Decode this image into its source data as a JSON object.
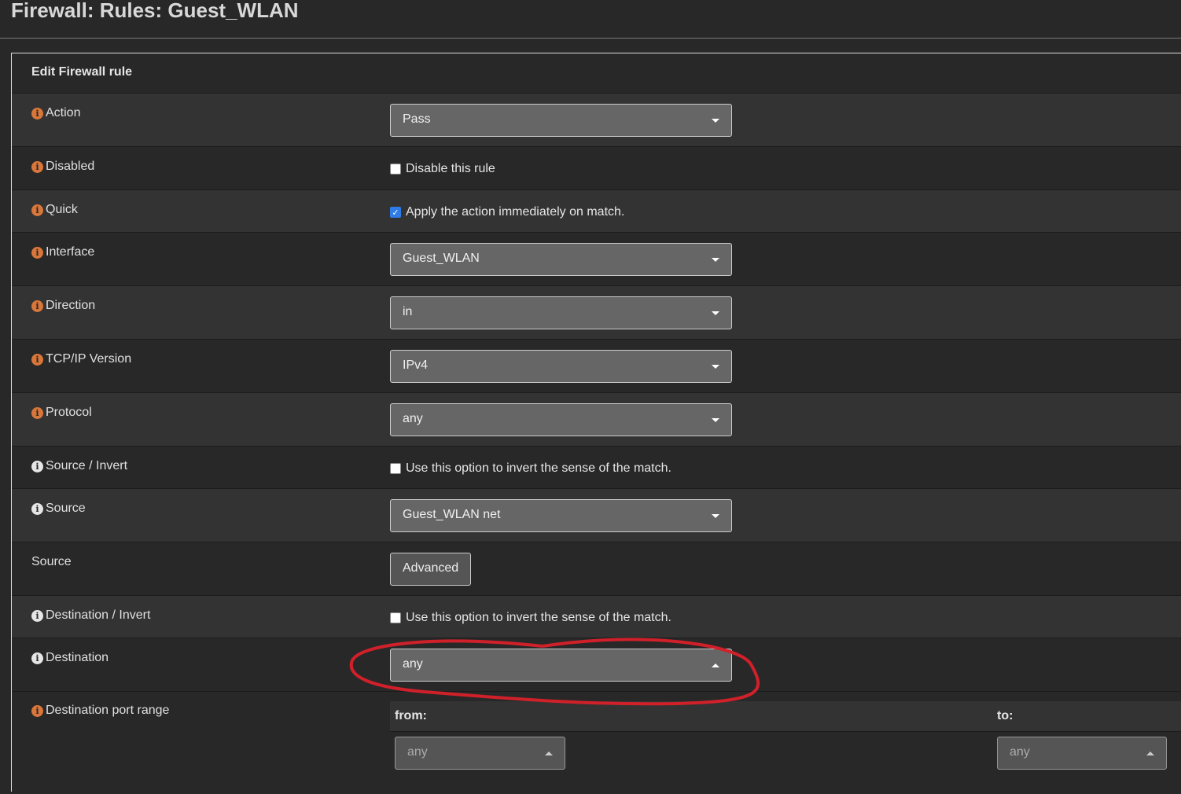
{
  "page_title": "Firewall: Rules: Guest_WLAN",
  "panel_title": "Edit Firewall rule",
  "rows": {
    "action": {
      "label": "Action",
      "value": "Pass"
    },
    "disabled": {
      "label": "Disabled",
      "text": "Disable this rule",
      "checked": false
    },
    "quick": {
      "label": "Quick",
      "text": "Apply the action immediately on match.",
      "checked": true
    },
    "interface": {
      "label": "Interface",
      "value": "Guest_WLAN"
    },
    "direction": {
      "label": "Direction",
      "value": "in"
    },
    "ipversion": {
      "label": "TCP/IP Version",
      "value": "IPv4"
    },
    "protocol": {
      "label": "Protocol",
      "value": "any"
    },
    "source_invert": {
      "label": "Source / Invert",
      "text": "Use this option to invert the sense of the match.",
      "checked": false
    },
    "source": {
      "label": "Source",
      "value": "Guest_WLAN net"
    },
    "source_adv": {
      "label": "Source",
      "button": "Advanced"
    },
    "dest_invert": {
      "label": "Destination / Invert",
      "text": "Use this option to invert the sense of the match.",
      "checked": false
    },
    "destination": {
      "label": "Destination",
      "value": "any"
    },
    "dest_port": {
      "label": "Destination port range",
      "from_label": "from:",
      "to_label": "to:",
      "from_value": "any",
      "to_value": "any"
    }
  },
  "colors": {
    "info_icon": "#d9773a",
    "annotation": "#d0202a",
    "checkbox_checked": "#2f7be8"
  }
}
